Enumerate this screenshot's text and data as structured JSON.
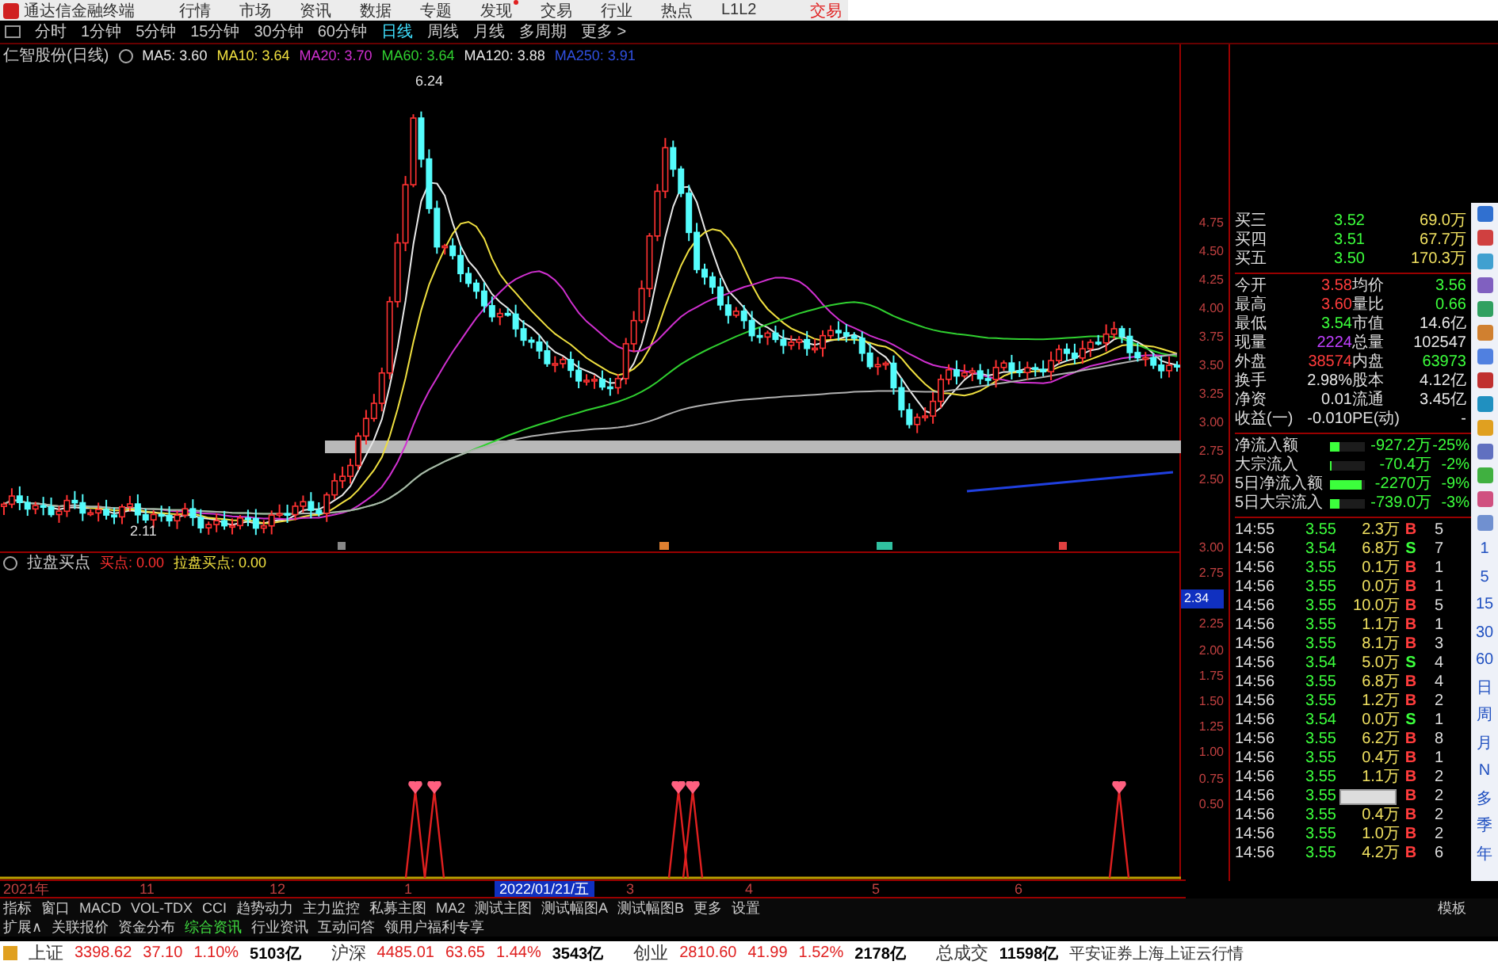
{
  "app_bar": {
    "title": "通达信金融终端",
    "menu": [
      {
        "label": "行情",
        "dot": false
      },
      {
        "label": "市场",
        "dot": false
      },
      {
        "label": "资讯",
        "dot": false
      },
      {
        "label": "数据",
        "dot": false
      },
      {
        "label": "专题",
        "dot": false
      },
      {
        "label": "发现",
        "dot": true
      },
      {
        "label": "交易",
        "dot": false
      },
      {
        "label": "行业",
        "dot": false
      },
      {
        "label": "热点",
        "dot": false
      },
      {
        "label": "L1L2",
        "dot": false
      }
    ],
    "trade_link": "交易"
  },
  "period_tabs": [
    {
      "label": "分时",
      "selected": false
    },
    {
      "label": "1分钟",
      "selected": false
    },
    {
      "label": "5分钟",
      "selected": false
    },
    {
      "label": "15分钟",
      "selected": false
    },
    {
      "label": "30分钟",
      "selected": false
    },
    {
      "label": "60分钟",
      "selected": false
    },
    {
      "label": "日线",
      "selected": true
    },
    {
      "label": "周线",
      "selected": false
    },
    {
      "label": "月线",
      "selected": false
    },
    {
      "label": "多周期",
      "selected": false
    },
    {
      "label": "更多 >",
      "selected": false
    }
  ],
  "ma_legend": {
    "stock": "仁智股份(日线)",
    "lines": [
      {
        "label": "MA5: 3.60",
        "color": "#e8e8e8"
      },
      {
        "label": "MA10: 3.64",
        "color": "#f0e040"
      },
      {
        "label": "MA20: 3.70",
        "color": "#d030d0"
      },
      {
        "label": "MA60: 3.64",
        "color": "#30d030"
      },
      {
        "label": "MA120: 3.88",
        "color": "#e8e8e8"
      },
      {
        "label": "MA250: 3.91",
        "color": "#3050e0"
      }
    ]
  },
  "main_chart": {
    "high_label": "6.24",
    "low_label": "2.11",
    "price_axis": [
      "4.75",
      "4.50",
      "4.25",
      "4.00",
      "3.75",
      "3.50",
      "3.25",
      "3.00",
      "2.75",
      "2.50"
    ]
  },
  "indicator": {
    "name": "拉盘买点",
    "values": [
      {
        "label": "买点: 0.00",
        "color": "#ff3030"
      },
      {
        "label": "拉盘买点: 0.00",
        "color": "#f0e040"
      }
    ],
    "axis": [
      "3.00",
      "2.75",
      "2.25",
      "2.00",
      "1.75",
      "1.50",
      "1.25",
      "1.00",
      "0.75",
      "0.50"
    ],
    "current_value": "2.34"
  },
  "order_book": [
    {
      "label": "买三",
      "price": "3.52",
      "volume": "69.0万"
    },
    {
      "label": "买四",
      "price": "3.51",
      "volume": "67.7万"
    },
    {
      "label": "买五",
      "price": "3.50",
      "volume": "170.3万"
    }
  ],
  "quote_stats": [
    {
      "cells": [
        {
          "label": "今开",
          "value": "3.58",
          "color": "#ff3c3c"
        },
        {
          "label": "均价",
          "value": "3.56",
          "color": "#3cff3c"
        }
      ]
    },
    {
      "cells": [
        {
          "label": "最高",
          "value": "3.60",
          "color": "#ff3c3c"
        },
        {
          "label": "量比",
          "value": "0.66",
          "color": "#3cff3c"
        }
      ]
    },
    {
      "cells": [
        {
          "label": "最低",
          "value": "3.54",
          "color": "#3cff3c"
        },
        {
          "label": "市值",
          "value": "14.6亿",
          "color": "#e8e8e8"
        }
      ]
    },
    {
      "cells": [
        {
          "label": "现量",
          "value": "2224",
          "color": "#c040ff"
        },
        {
          "label": "总量",
          "value": "102547",
          "color": "#e8e8e8"
        }
      ]
    },
    {
      "cells": [
        {
          "label": "外盘",
          "value": "38574",
          "color": "#ff3c3c"
        },
        {
          "label": "内盘",
          "value": "63973",
          "color": "#3cff3c"
        }
      ]
    },
    {
      "cells": [
        {
          "label": "换手",
          "value": "2.98%",
          "color": "#e8e8e8"
        },
        {
          "label": "股本",
          "value": "4.12亿",
          "color": "#e8e8e8"
        }
      ]
    },
    {
      "cells": [
        {
          "label": "净资",
          "value": "0.01",
          "color": "#e8e8e8"
        },
        {
          "label": "流通",
          "value": "3.45亿",
          "color": "#e8e8e8"
        }
      ]
    },
    {
      "cells": [
        {
          "label": "收益(一)",
          "value": "-0.010",
          "color": "#e8e8e8"
        },
        {
          "label": "PE(动)",
          "value": "-",
          "color": "#e8e8e8"
        }
      ]
    }
  ],
  "fund_flows": [
    {
      "label": "净流入额",
      "level": 0.25,
      "value": "-927.2万",
      "percent": "-25%"
    },
    {
      "label": "大宗流入",
      "level": 0.05,
      "value": "-70.4万",
      "percent": "-2%"
    },
    {
      "label": "5日净流入额",
      "level": 0.9,
      "value": "-2270万",
      "percent": "-9%"
    },
    {
      "label": "5日大宗流入",
      "level": 0.25,
      "value": "-739.0万",
      "percent": "-3%"
    }
  ],
  "trades": [
    {
      "time": "14:55",
      "price": "3.55",
      "volume": "2.3万",
      "side": "B",
      "kind": "buy",
      "count": "5"
    },
    {
      "time": "14:56",
      "price": "3.54",
      "volume": "6.8万",
      "side": "S",
      "kind": "sell",
      "count": "7"
    },
    {
      "time": "14:56",
      "price": "3.55",
      "volume": "0.1万",
      "side": "B",
      "kind": "buy",
      "count": "1"
    },
    {
      "time": "14:56",
      "price": "3.55",
      "volume": "0.0万",
      "side": "B",
      "kind": "buy",
      "count": "1"
    },
    {
      "time": "14:56",
      "price": "3.55",
      "volume": "10.0万",
      "side": "B",
      "kind": "buy",
      "count": "5"
    },
    {
      "time": "14:56",
      "price": "3.55",
      "volume": "1.1万",
      "side": "B",
      "kind": "buy",
      "count": "1"
    },
    {
      "time": "14:56",
      "price": "3.55",
      "volume": "8.1万",
      "side": "B",
      "kind": "buy",
      "count": "3"
    },
    {
      "time": "14:56",
      "price": "3.54",
      "volume": "5.0万",
      "side": "S",
      "kind": "sell",
      "count": "4"
    },
    {
      "time": "14:56",
      "price": "3.55",
      "volume": "6.8万",
      "side": "B",
      "kind": "buy",
      "count": "4"
    },
    {
      "time": "14:56",
      "price": "3.55",
      "volume": "1.2万",
      "side": "B",
      "kind": "buy",
      "count": "2"
    },
    {
      "time": "14:56",
      "price": "3.54",
      "volume": "0.0万",
      "side": "S",
      "kind": "sell",
      "count": "1"
    },
    {
      "time": "14:56",
      "price": "3.55",
      "volume": "6.2万",
      "side": "B",
      "kind": "buy",
      "count": "8"
    },
    {
      "time": "14:56",
      "price": "3.55",
      "volume": "0.4万",
      "side": "B",
      "kind": "buy",
      "count": "1"
    },
    {
      "time": "14:56",
      "price": "3.55",
      "volume": "1.1万",
      "side": "B",
      "kind": "buy",
      "count": "2"
    },
    {
      "time": "14:56",
      "price": "3.55",
      "side": "B",
      "kind": "buy",
      "count": "2"
    },
    {
      "time": "14:56",
      "price": "3.55",
      "volume": "0.4万",
      "side": "B",
      "kind": "buy",
      "count": "2"
    },
    {
      "time": "14:56",
      "price": "3.55",
      "volume": "1.0万",
      "side": "B",
      "kind": "buy",
      "count": "2"
    },
    {
      "time": "14:56",
      "price": "3.55",
      "volume": "4.2万",
      "side": "B",
      "kind": "buy",
      "count": "6"
    }
  ],
  "period_buttons": [
    "1",
    "5",
    "15",
    "30",
    "60",
    "日",
    "周",
    "月",
    "N",
    "多",
    "季",
    "年"
  ],
  "time_axis": [
    {
      "label": "2021年",
      "selected": false
    },
    {
      "label": "11",
      "selected": false
    },
    {
      "label": "12",
      "selected": false
    },
    {
      "label": "1",
      "selected": false
    },
    {
      "label": "2022/01/21/五",
      "selected": true
    },
    {
      "label": "3",
      "selected": false
    },
    {
      "label": "4",
      "selected": false
    },
    {
      "label": "5",
      "selected": false
    },
    {
      "label": "6",
      "selected": false
    }
  ],
  "indicator_tabs": [
    "指标",
    "窗口",
    "MACD",
    "VOL-TDX",
    "CCI",
    "趋势动力",
    "主力监控",
    "私募主图",
    "MA2",
    "测试主图",
    "测试幅图A",
    "测试幅图B",
    "更多",
    "设置"
  ],
  "template_button": "模板",
  "extension_tabs": [
    {
      "label": "扩展∧",
      "selected": false
    },
    {
      "label": "关联报价",
      "selected": false
    },
    {
      "label": "资金分布",
      "selected": false
    },
    {
      "label": "综合资讯",
      "selected": true
    },
    {
      "label": "行业资讯",
      "selected": false
    },
    {
      "label": "互动问答",
      "selected": false
    },
    {
      "label": "领用户福利专享",
      "selected": false
    }
  ],
  "market_bar": {
    "indexes": [
      {
        "name": "上证",
        "value": "3398.62",
        "change": "37.10",
        "percent": "1.10%",
        "turnover": "5103亿"
      },
      {
        "name": "沪深",
        "value": "4485.01",
        "change": "63.65",
        "percent": "1.44%",
        "turnover": "3543亿"
      },
      {
        "name": "创业",
        "value": "2810.60",
        "change": "41.99",
        "percent": "1.52%",
        "turnover": "2178亿"
      }
    ],
    "total_label": "总成交",
    "total": "11598亿",
    "source": "平安证券上海上证云行情"
  }
}
